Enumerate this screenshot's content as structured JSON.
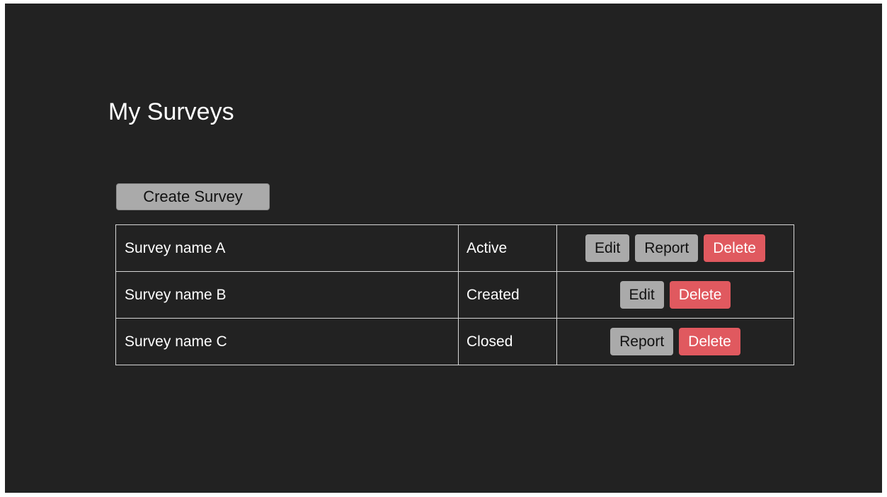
{
  "page": {
    "title": "My Surveys"
  },
  "toolbar": {
    "create_label": "Create Survey"
  },
  "colors": {
    "background": "#222222",
    "button_gray": "#aaaaaa",
    "button_danger": "#e0595f",
    "table_border": "#d6d6d6"
  },
  "surveys": [
    {
      "name": "Survey name A",
      "status": "Active",
      "actions": {
        "edit": "Edit",
        "report": "Report",
        "delete": "Delete"
      }
    },
    {
      "name": "Survey name B",
      "status": "Created",
      "actions": {
        "edit": "Edit",
        "delete": "Delete"
      }
    },
    {
      "name": "Survey name C",
      "status": "Closed",
      "actions": {
        "report": "Report",
        "delete": "Delete"
      }
    }
  ]
}
